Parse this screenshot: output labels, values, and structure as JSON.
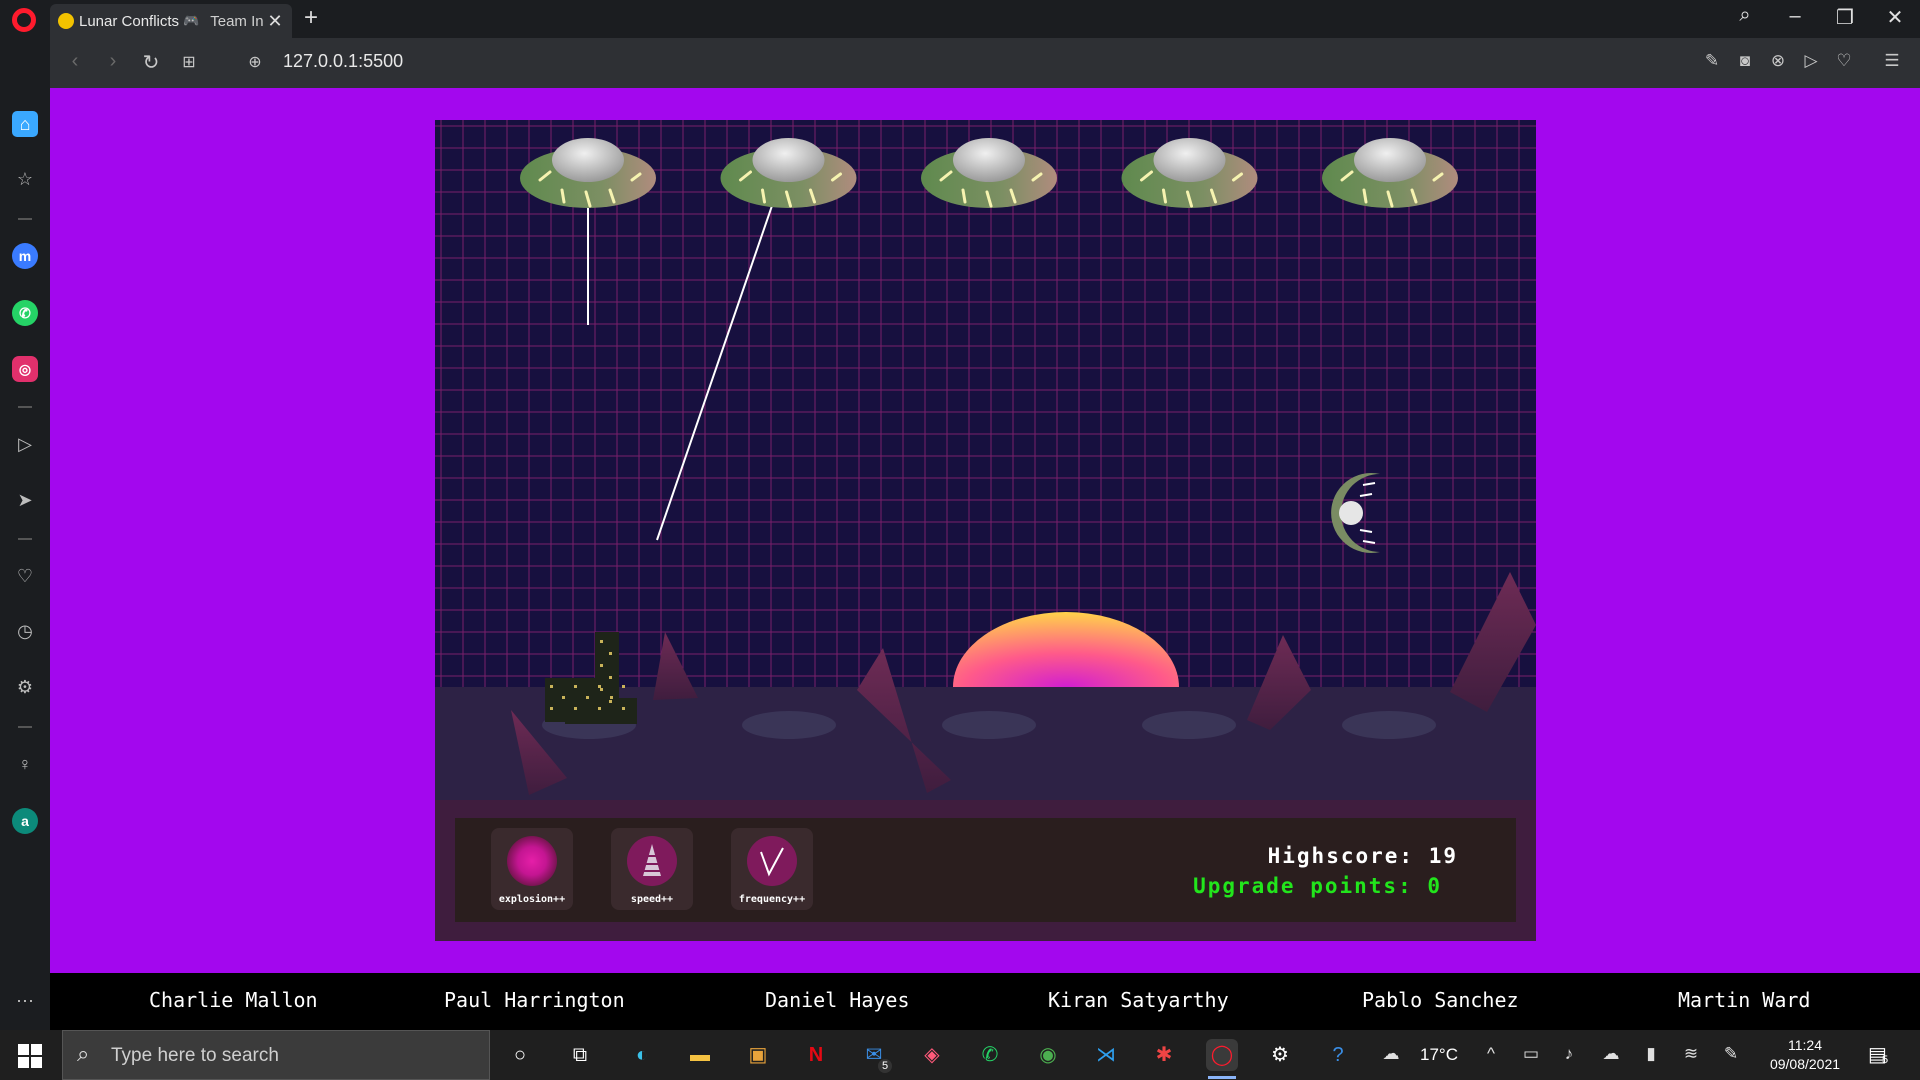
{
  "browser": {
    "tab": {
      "title": "Lunar Conflicts",
      "secondary": "Team In",
      "close_glyph": "✕",
      "favicon": "gamepad-favicon"
    },
    "new_tab_glyph": "+",
    "url": "127.0.0.1:5500",
    "window_controls": [
      "search-icon",
      "minimize-icon",
      "restore-icon",
      "close-icon"
    ],
    "sidebar_icons": [
      "home-icon",
      "star-icon",
      "messenger-icon",
      "whatsapp-icon",
      "instagram-icon",
      "player-icon",
      "flow-icon",
      "heart-icon",
      "history-icon",
      "settings-icon",
      "tips-icon",
      "aria-icon",
      "more-icon"
    ]
  },
  "game": {
    "colors": {
      "page_bg": "#a307ee",
      "sky": "#17103f",
      "grid": "#7a1f6b",
      "ground": "#2d2245",
      "hud": "#2a1e1e",
      "score_white": "#ffffff",
      "points_green": "#22e51c"
    },
    "ufo_count": 5,
    "upgrades": [
      {
        "label": "explosion++",
        "icon": "explosion-icon"
      },
      {
        "label": "speed++",
        "icon": "speed-icon"
      },
      {
        "label": "frequency++",
        "icon": "frequency-icon"
      }
    ],
    "highscore_text": "Highscore: 19",
    "upgrade_points_text": "Upgrade points: 0"
  },
  "credits": [
    "Charlie Mallon",
    "Paul Harrington",
    "Daniel Hayes",
    "Kiran Satyarthy",
    "Pablo Sanchez",
    "Martin Ward"
  ],
  "taskbar": {
    "search_placeholder": "Type here to search",
    "temperature": "17°C",
    "time": "11:24",
    "date": "09/08/2021",
    "mail_badge": "5",
    "notification_badge": "5"
  }
}
